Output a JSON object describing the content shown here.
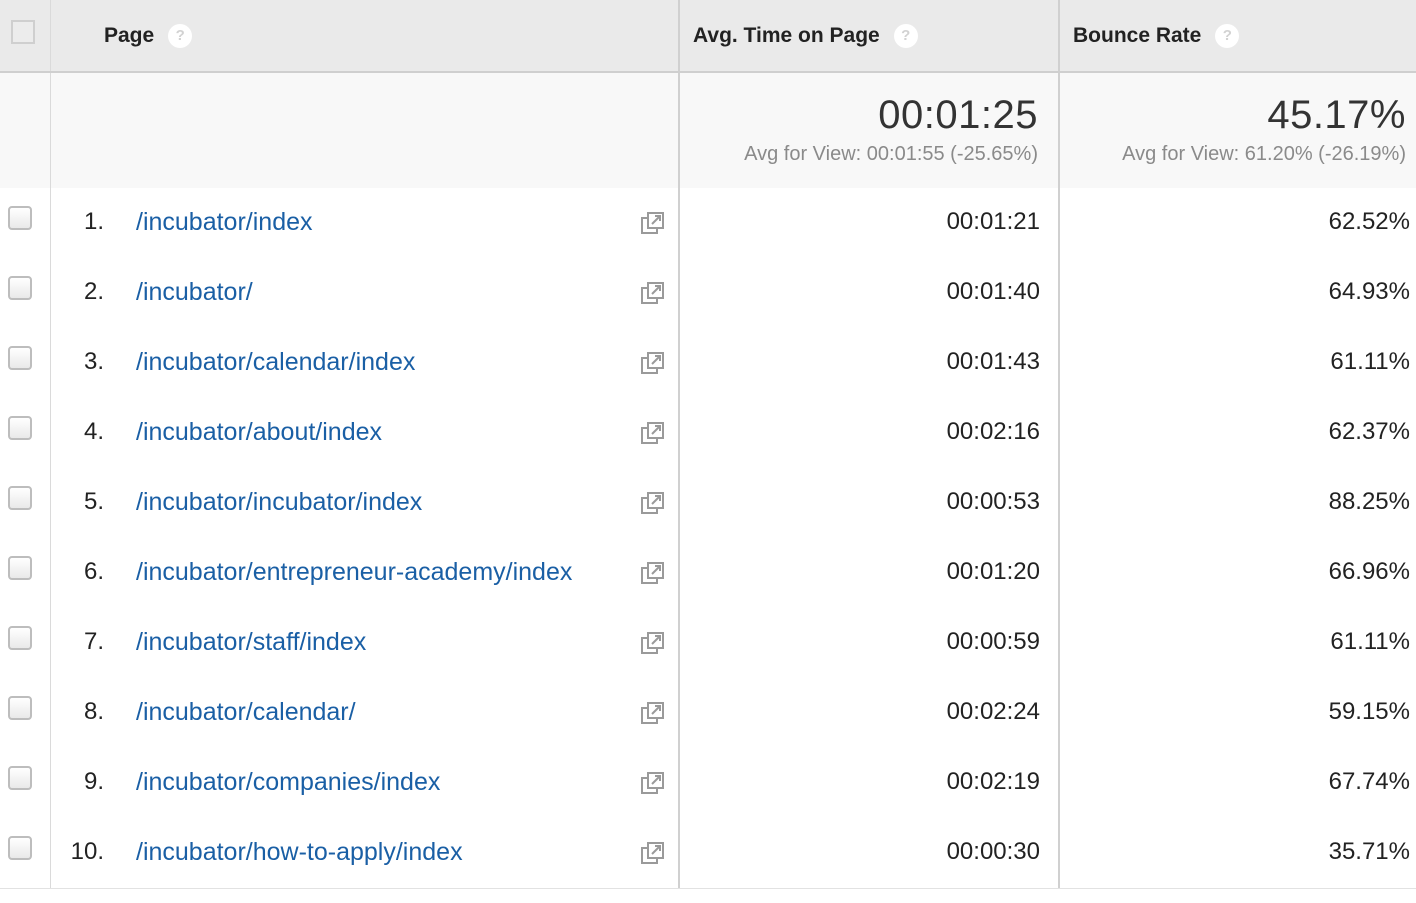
{
  "header": {
    "page_label": "Page",
    "time_label": "Avg. Time on Page",
    "bounce_label": "Bounce Rate",
    "help_glyph": "?"
  },
  "summary": {
    "time_value": "00:01:25",
    "time_sub": "Avg for View: 00:01:55 (-25.65%)",
    "bounce_value": "45.17%",
    "bounce_sub": "Avg for View: 61.20% (-26.19%)"
  },
  "rows": [
    {
      "index": "1.",
      "page": "/incubator/index",
      "time": "00:01:21",
      "bounce": "62.52%"
    },
    {
      "index": "2.",
      "page": "/incubator/",
      "time": "00:01:40",
      "bounce": "64.93%"
    },
    {
      "index": "3.",
      "page": "/incubator/calendar/index",
      "time": "00:01:43",
      "bounce": "61.11%"
    },
    {
      "index": "4.",
      "page": "/incubator/about/index",
      "time": "00:02:16",
      "bounce": "62.37%"
    },
    {
      "index": "5.",
      "page": "/incubator/incubator/index",
      "time": "00:00:53",
      "bounce": "88.25%"
    },
    {
      "index": "6.",
      "page": "/incubator/entrepreneur-academy/index",
      "time": "00:01:20",
      "bounce": "66.96%"
    },
    {
      "index": "7.",
      "page": "/incubator/staff/index",
      "time": "00:00:59",
      "bounce": "61.11%"
    },
    {
      "index": "8.",
      "page": "/incubator/calendar/",
      "time": "00:02:24",
      "bounce": "59.15%"
    },
    {
      "index": "9.",
      "page": "/incubator/companies/index",
      "time": "00:02:19",
      "bounce": "67.74%"
    },
    {
      "index": "10.",
      "page": "/incubator/how-to-apply/index",
      "time": "00:00:30",
      "bounce": "35.71%"
    }
  ],
  "icons": {
    "help": "help-icon",
    "external_link": "external-link-icon",
    "link_color": "#1a5fa5"
  }
}
